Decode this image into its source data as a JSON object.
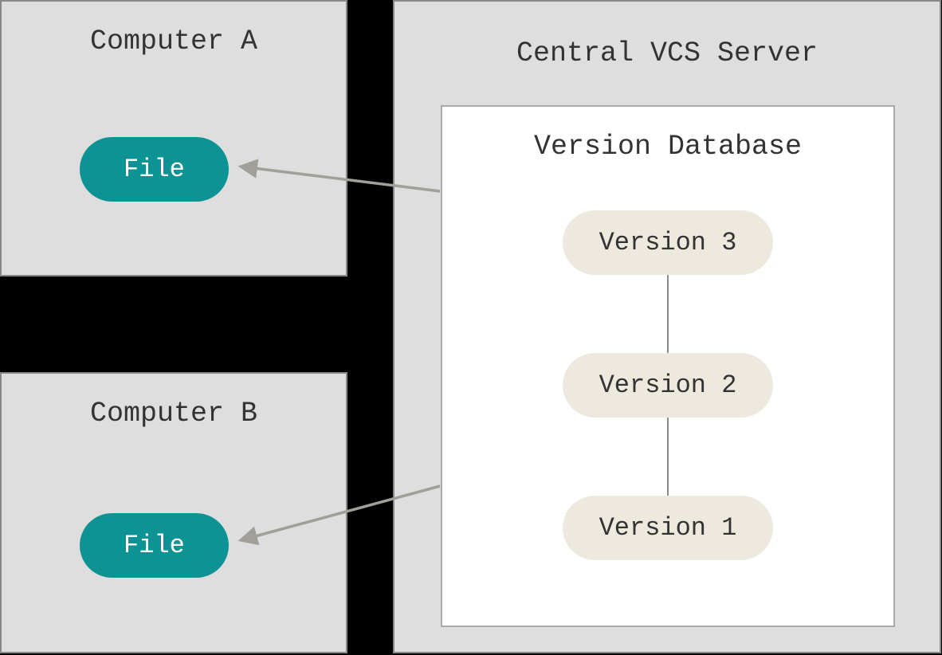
{
  "computer_a": {
    "title": "Computer A",
    "file_label": "File"
  },
  "computer_b": {
    "title": "Computer B",
    "file_label": "File"
  },
  "server": {
    "title": "Central VCS Server",
    "database": {
      "title": "Version Database",
      "versions": [
        "Version 3",
        "Version 2",
        "Version 1"
      ]
    }
  }
}
